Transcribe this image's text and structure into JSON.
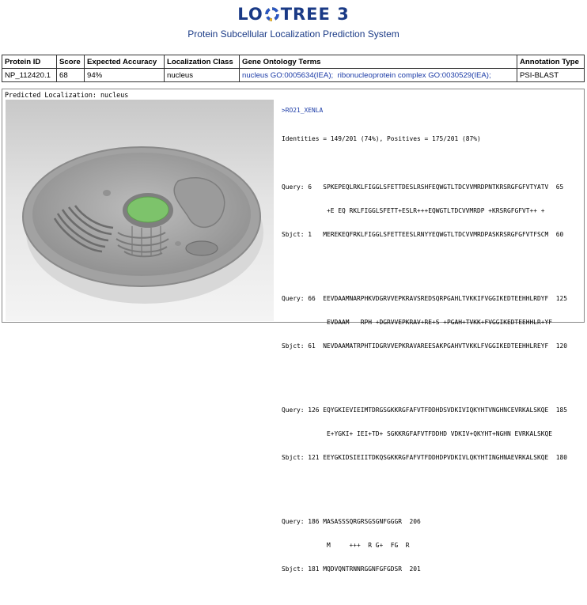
{
  "app": {
    "logo_left": "LO",
    "logo_right": "TREE 3",
    "subtitle": "Protein Subcellular Localization Prediction System"
  },
  "results_table": {
    "headers": [
      "Protein ID",
      "Score",
      "Expected Accuracy",
      "Localization Class",
      "Gene Ontology Terms",
      "Annotation Type"
    ],
    "row": {
      "protein_id": "NP_112420.1",
      "score": "68",
      "expected_accuracy": "94%",
      "localization_class": "nucleus",
      "go_term_1": "nucleus GO:0005634(IEA);",
      "go_term_2": "ribonucleoprotein complex GO:0030529(IEA);",
      "annotation_type": "PSI-BLAST"
    }
  },
  "visualization": {
    "label": "Predicted Localization: nucleus",
    "highlight_color": "#7dc36b"
  },
  "alignment": {
    "header": ">RO21_XENLA",
    "identities": "Identities = 149/201 (74%), Positives = 175/201 (87%)",
    "blocks": [
      {
        "query": "Query: 6   SPKEPEQLRKLFIGGLSFETTDESLRSHFEQWGTLTDCVVMRDPNTKRSRGFGFVTYATV  65",
        "mid": "            +E EQ RKLFIGGLSFETT+ESLR+++EQWGTLTDCVVMRDP +KRSRGFGFVT++ +",
        "sbjct": "Sbjct: 1   MEREKEQFRKLFIGGLSFETTEESLRNYYEQWGTLTDCVVMRDPASKRSRGFGFVTFSCM  60"
      },
      {
        "query": "Query: 66  EEVDAAMNARPHKVDGRVVEPKRAVSREDSQRPGAHLTVKKIFVGGIKEDTEEHHLRDYF  125",
        "mid": "            EVDAAM   RPH +DGRVVEPKRAV+RE+S +PGAH+TVKK+FVGGIKEDTEEHHLR+YF",
        "sbjct": "Sbjct: 61  NEVDAAMATRPHTIDGRVVEPKRAVAREESAKPGAHVTVKKLFVGGIKEDTEEHHLREYF  120"
      },
      {
        "query": "Query: 126 EQYGKIEVIEIMTDRGSGKKRGFAFVTFDDHDSVDKIVIQKYHTVNGHNCEVRKALSKQE  185",
        "mid": "            E+YGKI+ IEI+TD+ SGKKRGFAFVTFDDHD VDKIV+QKYHT+NGHN EVRKALSKQE",
        "sbjct": "Sbjct: 121 EEYGKIDSIEIITDKQSGKKRGFAFVTFDDHDPVDKIVLQKYHTINGHNAEVRKALSKQE  180"
      },
      {
        "query": "Query: 186 MASASSSQRGRSGSGNFGGGR  206",
        "mid": "            M     +++  R G+  FG  R",
        "sbjct": "Sbjct: 181 MQDVQNTRNNRGGNFGFGDSR  201"
      }
    ]
  }
}
